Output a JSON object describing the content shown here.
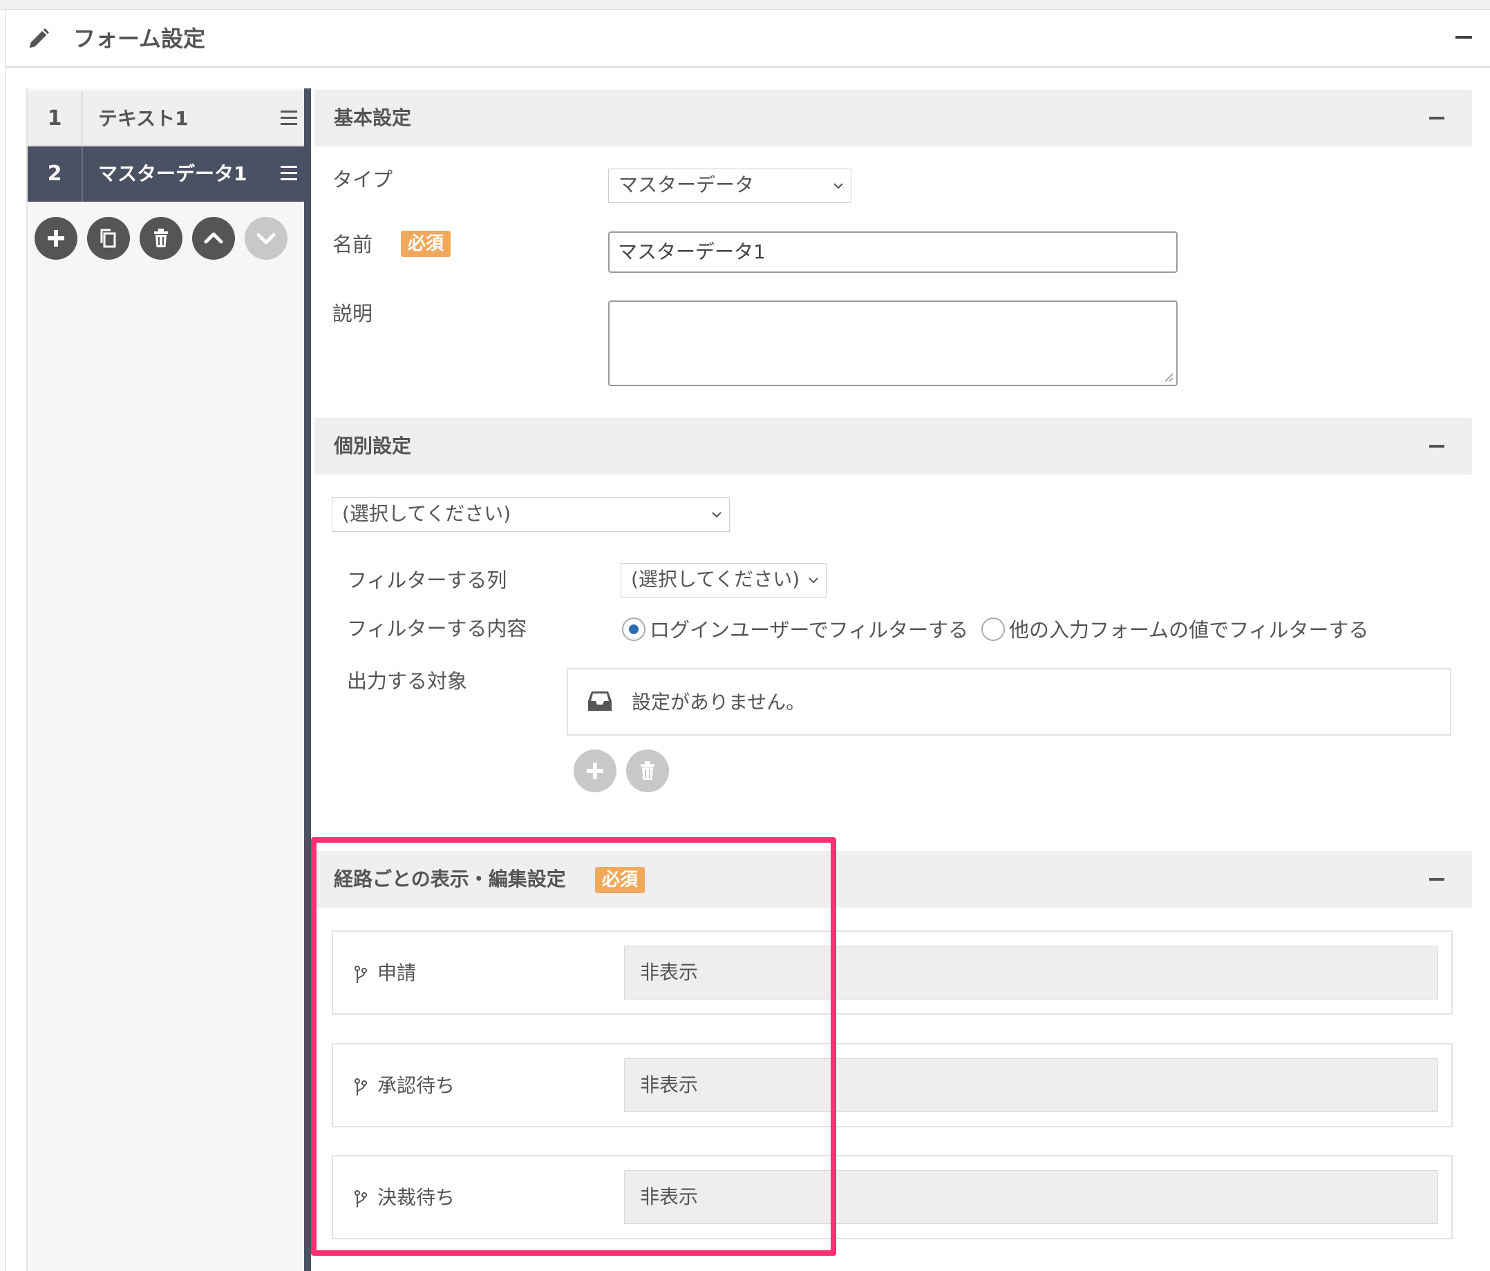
{
  "header": {
    "title": "フォーム設定"
  },
  "sidebar": {
    "items": [
      {
        "num": "1",
        "label": "テキスト1"
      },
      {
        "num": "2",
        "label": "マスターデータ1"
      }
    ],
    "controls": [
      "add-icon",
      "copy-icon",
      "trash-icon",
      "up-icon",
      "down-icon"
    ]
  },
  "basic": {
    "title": "基本設定",
    "type_label": "タイプ",
    "type_value": "マスターデータ",
    "name_label": "名前",
    "required": "必須",
    "name_value": "マスターデータ1",
    "desc_label": "説明",
    "desc_value": ""
  },
  "individual": {
    "title": "個別設定",
    "master_select": "(選択してください)",
    "filter_col_label": "フィルターする列",
    "filter_col_value": "(選択してください)",
    "filter_content_label": "フィルターする内容",
    "radio_login": "ログインユーザーでフィルターする",
    "radio_other": "他の入力フォームの値でフィルターする",
    "selected_radio": "login",
    "output_label": "出力する対象",
    "empty_text": "設定がありません。"
  },
  "route": {
    "title": "経路ごとの表示・編集設定",
    "required": "必須",
    "rows": [
      {
        "label": "申請",
        "value": "非表示"
      },
      {
        "label": "承認待ち",
        "value": "非表示"
      },
      {
        "label": "決裁待ち",
        "value": "非表示"
      }
    ]
  },
  "colors": {
    "highlight": "#ff2e75",
    "required": "#f0a95a",
    "sidebar_active": "#4a5163"
  }
}
